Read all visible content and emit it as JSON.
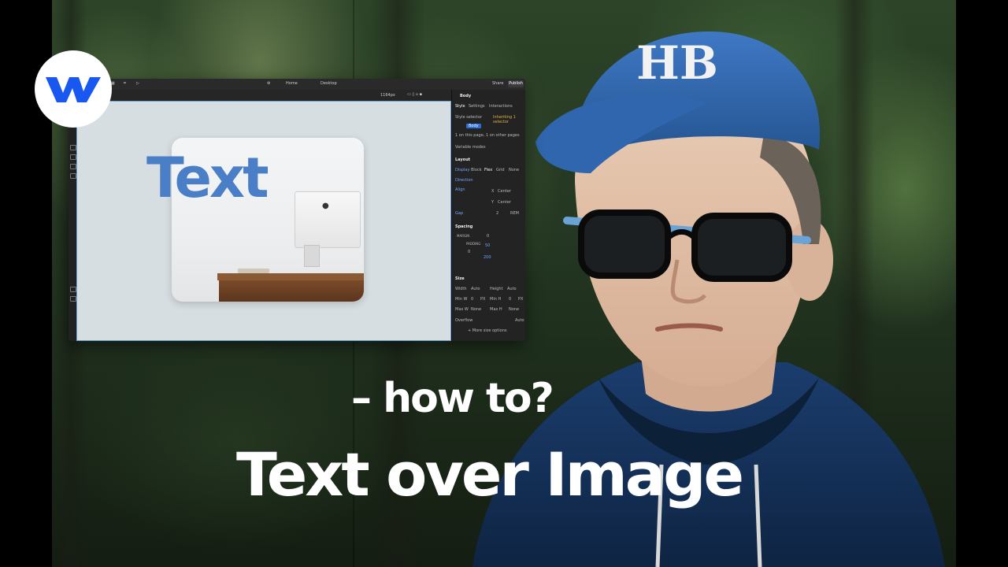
{
  "thumbnail": {
    "subtitle": "– how to?",
    "title": "Text over Image"
  },
  "logo": {
    "brand": "Webflow",
    "icon": "webflow-w-icon",
    "color": "#1858f0"
  },
  "avatar": {
    "cap_text": "HB"
  },
  "editor": {
    "topbar": {
      "page_label": "Home",
      "device_label": "Desktop",
      "share_label": "Share",
      "publish_label": "Publish",
      "width_label": "1164px"
    },
    "canvas": {
      "overlay_text": "Text",
      "text_color": "#4a7fc8"
    },
    "panel": {
      "element_name": "Body",
      "tabs": [
        "Style",
        "Settings",
        "Interactions"
      ],
      "style_selector_label": "Style selector",
      "inheriting_label": "Inheriting 1 selector",
      "selector_tag": "Body",
      "usage_note": "1 on this page, 1 on other pages",
      "variable_modes_label": "Variable modes",
      "layout_label": "Layout",
      "display_label": "Display",
      "display_options": [
        "Block",
        "Flex",
        "Grid",
        "None"
      ],
      "direction_label": "Direction",
      "align_label": "Align",
      "align_x_label": "X",
      "align_x_value": "Center",
      "align_y_label": "Y",
      "align_y_value": "Center",
      "gap_label": "Gap",
      "gap_value": "2",
      "gap_unit": "REM",
      "spacing_label": "Spacing",
      "margin_label": "MARGIN",
      "margin_value": "0",
      "padding_label": "PADDING",
      "padding_top": "50",
      "padding_bottom": "200",
      "padding_side": "0",
      "size_label": "Size",
      "width_label": "Width",
      "width_value": "Auto",
      "height_label": "Height",
      "height_value": "Auto",
      "min_w_label": "Min W",
      "min_w_value": "0",
      "min_w_unit": "PX",
      "min_h_label": "Min H",
      "min_h_value": "0",
      "min_h_unit": "PX",
      "max_w_label": "Max W",
      "max_w_value": "None",
      "max_h_label": "Max H",
      "max_h_value": "None",
      "overflow_label": "Overflow",
      "overflow_value": "Auto",
      "more_size_label": "+ More size options"
    }
  }
}
